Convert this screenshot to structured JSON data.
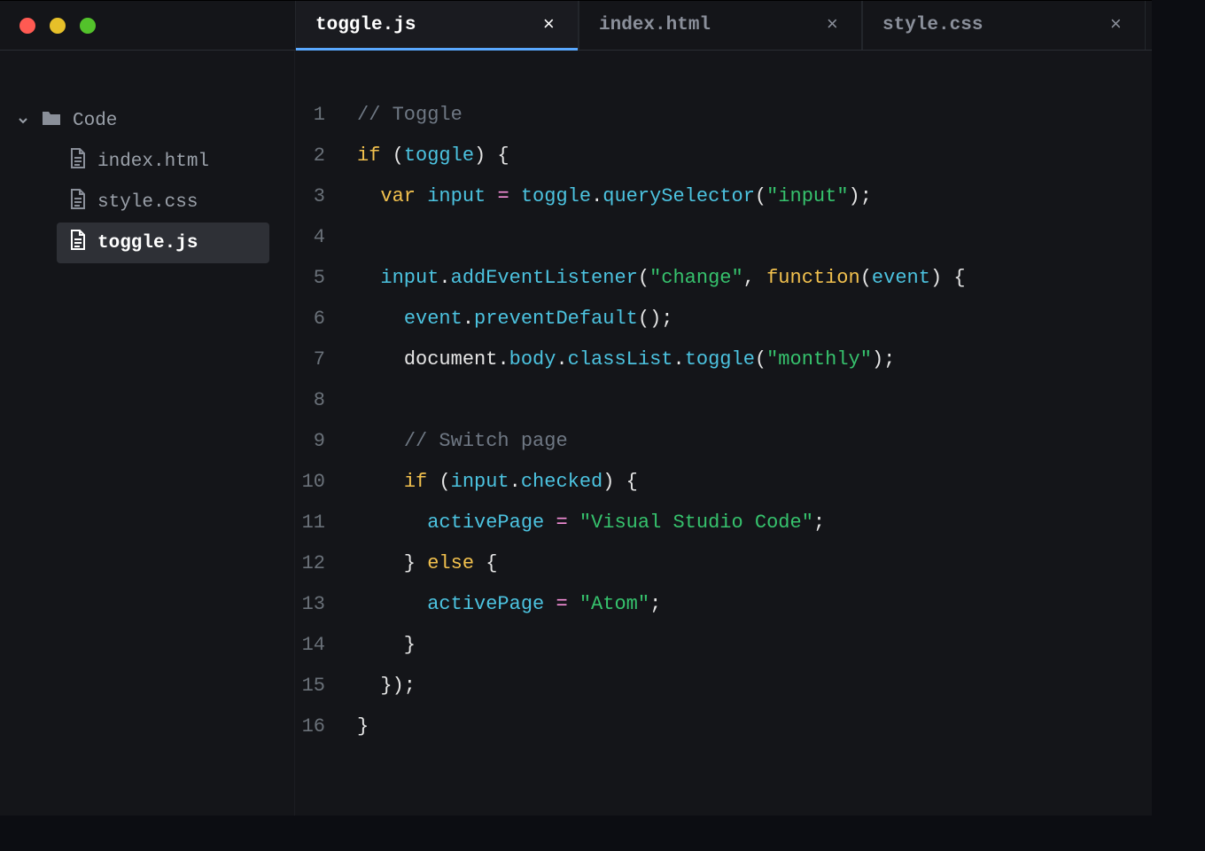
{
  "tabs": [
    {
      "label": "toggle.js",
      "active": true
    },
    {
      "label": "index.html",
      "active": false
    },
    {
      "label": "style.css",
      "active": false
    }
  ],
  "sidebar": {
    "root": {
      "label": "Code",
      "expanded": true
    },
    "items": [
      {
        "label": "index.html",
        "selected": false
      },
      {
        "label": "style.css",
        "selected": false
      },
      {
        "label": "toggle.js",
        "selected": true
      }
    ]
  },
  "code": {
    "lines": [
      {
        "n": "1",
        "tokens": [
          {
            "t": "// Toggle",
            "c": "comment"
          }
        ]
      },
      {
        "n": "2",
        "tokens": [
          {
            "t": "if",
            "c": "keyword"
          },
          {
            "t": " ("
          },
          {
            "t": "toggle",
            "c": "prop"
          },
          {
            "t": ") {"
          }
        ]
      },
      {
        "n": "3",
        "tokens": [
          {
            "t": "  "
          },
          {
            "t": "var",
            "c": "keyword"
          },
          {
            "t": " "
          },
          {
            "t": "input",
            "c": "prop"
          },
          {
            "t": " "
          },
          {
            "t": "=",
            "c": "var"
          },
          {
            "t": " "
          },
          {
            "t": "toggle",
            "c": "prop"
          },
          {
            "t": "."
          },
          {
            "t": "querySelector",
            "c": "prop"
          },
          {
            "t": "("
          },
          {
            "t": "\"input\"",
            "c": "string"
          },
          {
            "t": ");"
          }
        ]
      },
      {
        "n": "4",
        "tokens": []
      },
      {
        "n": "5",
        "tokens": [
          {
            "t": "  "
          },
          {
            "t": "input",
            "c": "prop"
          },
          {
            "t": "."
          },
          {
            "t": "addEventListener",
            "c": "prop"
          },
          {
            "t": "("
          },
          {
            "t": "\"change\"",
            "c": "string"
          },
          {
            "t": ", "
          },
          {
            "t": "function",
            "c": "keyword"
          },
          {
            "t": "("
          },
          {
            "t": "event",
            "c": "prop"
          },
          {
            "t": ") {"
          }
        ]
      },
      {
        "n": "6",
        "tokens": [
          {
            "t": "    "
          },
          {
            "t": "event",
            "c": "prop"
          },
          {
            "t": "."
          },
          {
            "t": "preventDefault",
            "c": "prop"
          },
          {
            "t": "();"
          }
        ]
      },
      {
        "n": "7",
        "tokens": [
          {
            "t": "    "
          },
          {
            "t": "document"
          },
          {
            "t": "."
          },
          {
            "t": "body",
            "c": "prop"
          },
          {
            "t": "."
          },
          {
            "t": "classList",
            "c": "prop"
          },
          {
            "t": "."
          },
          {
            "t": "toggle",
            "c": "prop"
          },
          {
            "t": "("
          },
          {
            "t": "\"monthly\"",
            "c": "string"
          },
          {
            "t": ");"
          }
        ]
      },
      {
        "n": "8",
        "tokens": []
      },
      {
        "n": "9",
        "tokens": [
          {
            "t": "    "
          },
          {
            "t": "// Switch page",
            "c": "comment"
          }
        ]
      },
      {
        "n": "10",
        "tokens": [
          {
            "t": "    "
          },
          {
            "t": "if",
            "c": "keyword"
          },
          {
            "t": " ("
          },
          {
            "t": "input",
            "c": "prop"
          },
          {
            "t": "."
          },
          {
            "t": "checked",
            "c": "prop"
          },
          {
            "t": ") {"
          }
        ]
      },
      {
        "n": "11",
        "tokens": [
          {
            "t": "      "
          },
          {
            "t": "activePage",
            "c": "prop"
          },
          {
            "t": " "
          },
          {
            "t": "=",
            "c": "var"
          },
          {
            "t": " "
          },
          {
            "t": "\"Visual Studio Code\"",
            "c": "string"
          },
          {
            "t": ";"
          }
        ]
      },
      {
        "n": "12",
        "tokens": [
          {
            "t": "    } "
          },
          {
            "t": "else",
            "c": "keyword"
          },
          {
            "t": " {"
          }
        ]
      },
      {
        "n": "13",
        "tokens": [
          {
            "t": "      "
          },
          {
            "t": "activePage",
            "c": "prop"
          },
          {
            "t": " "
          },
          {
            "t": "=",
            "c": "var"
          },
          {
            "t": " "
          },
          {
            "t": "\"Atom\"",
            "c": "string"
          },
          {
            "t": ";"
          }
        ]
      },
      {
        "n": "14",
        "tokens": [
          {
            "t": "    }"
          }
        ]
      },
      {
        "n": "15",
        "tokens": [
          {
            "t": "  });"
          }
        ]
      },
      {
        "n": "16",
        "tokens": [
          {
            "t": "}"
          }
        ]
      }
    ]
  }
}
